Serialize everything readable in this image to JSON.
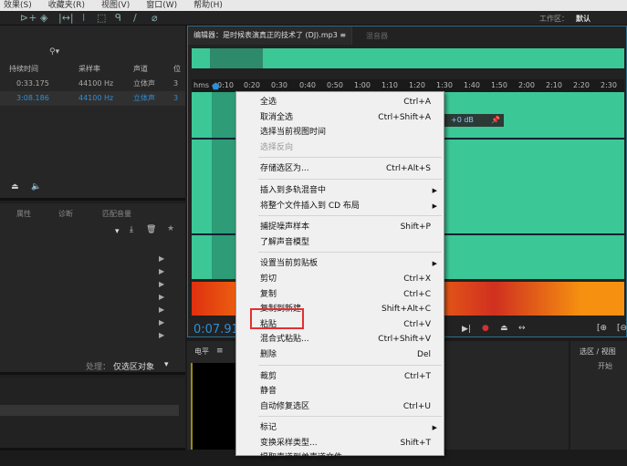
{
  "menubar": [
    "效果(S)",
    "收藏夹(R)",
    "视图(V)",
    "窗口(W)",
    "帮助(H)"
  ],
  "workspace": {
    "label": "工作区：",
    "value": "默认"
  },
  "files": {
    "columns": [
      "持续时间",
      "采样率",
      "声道",
      "位"
    ],
    "rows": [
      [
        "0:33.175",
        "44100 Hz",
        "立体声",
        "3"
      ],
      [
        "3:08.186",
        "44100 Hz",
        "立体声",
        "3"
      ]
    ]
  },
  "effects": {
    "tabs": [
      "属性",
      "诊断",
      "匹配音量"
    ],
    "process_label": "处理：",
    "process_value": "仅选区对象"
  },
  "editor": {
    "tab": "编辑器：是时候表演真正的技术了 (DJ).mp3",
    "tab2": "混音器",
    "ruler_unit": "hms",
    "ticks": [
      "0:10",
      "0:20",
      "0:30",
      "0:40",
      "0:50",
      "1:00",
      "1:10",
      "1:20",
      "1:30",
      "1:40",
      "1:50",
      "2:00",
      "2:10",
      "2:20",
      "2:30"
    ],
    "gain": "+0 dB",
    "time": "0:07.911"
  },
  "level": {
    "title": "电平"
  },
  "selview": {
    "title": "选区 / 视图",
    "start": "开始"
  },
  "context_menu": [
    {
      "label": "全选",
      "shortcut": "Ctrl+A"
    },
    {
      "label": "取消全选",
      "shortcut": "Ctrl+Shift+A"
    },
    {
      "label": "选择当前视图时间",
      "shortcut": ""
    },
    {
      "label": "选择反向",
      "shortcut": "",
      "disabled": true
    },
    {
      "sep": true
    },
    {
      "label": "存储选区为...",
      "shortcut": "Ctrl+Alt+S"
    },
    {
      "sep": true
    },
    {
      "label": "插入到多轨混音中",
      "submenu": true
    },
    {
      "label": "将整个文件插入到 CD 布局",
      "submenu": true
    },
    {
      "sep": true
    },
    {
      "label": "捕捉噪声样本",
      "shortcut": "Shift+P"
    },
    {
      "label": "了解声音模型",
      "shortcut": ""
    },
    {
      "sep": true
    },
    {
      "label": "设置当前剪贴板",
      "submenu": true
    },
    {
      "label": "剪切",
      "shortcut": "Ctrl+X"
    },
    {
      "label": "复制",
      "shortcut": "Ctrl+C"
    },
    {
      "label": "复制到新建",
      "shortcut": "Shift+Alt+C"
    },
    {
      "label": "粘贴",
      "shortcut": "Ctrl+V",
      "highlighted": true
    },
    {
      "label": "混合式粘贴...",
      "shortcut": "Ctrl+Shift+V"
    },
    {
      "label": "删除",
      "shortcut": "Del"
    },
    {
      "sep": true
    },
    {
      "label": "裁剪",
      "shortcut": "Ctrl+T"
    },
    {
      "label": "静音",
      "shortcut": ""
    },
    {
      "label": "自动修复选区",
      "shortcut": "Ctrl+U"
    },
    {
      "sep": true
    },
    {
      "label": "标记",
      "submenu": true
    },
    {
      "label": "变换采样类型...",
      "shortcut": "Shift+T"
    },
    {
      "label": "提取声道到单声道文件",
      "shortcut": ""
    }
  ]
}
